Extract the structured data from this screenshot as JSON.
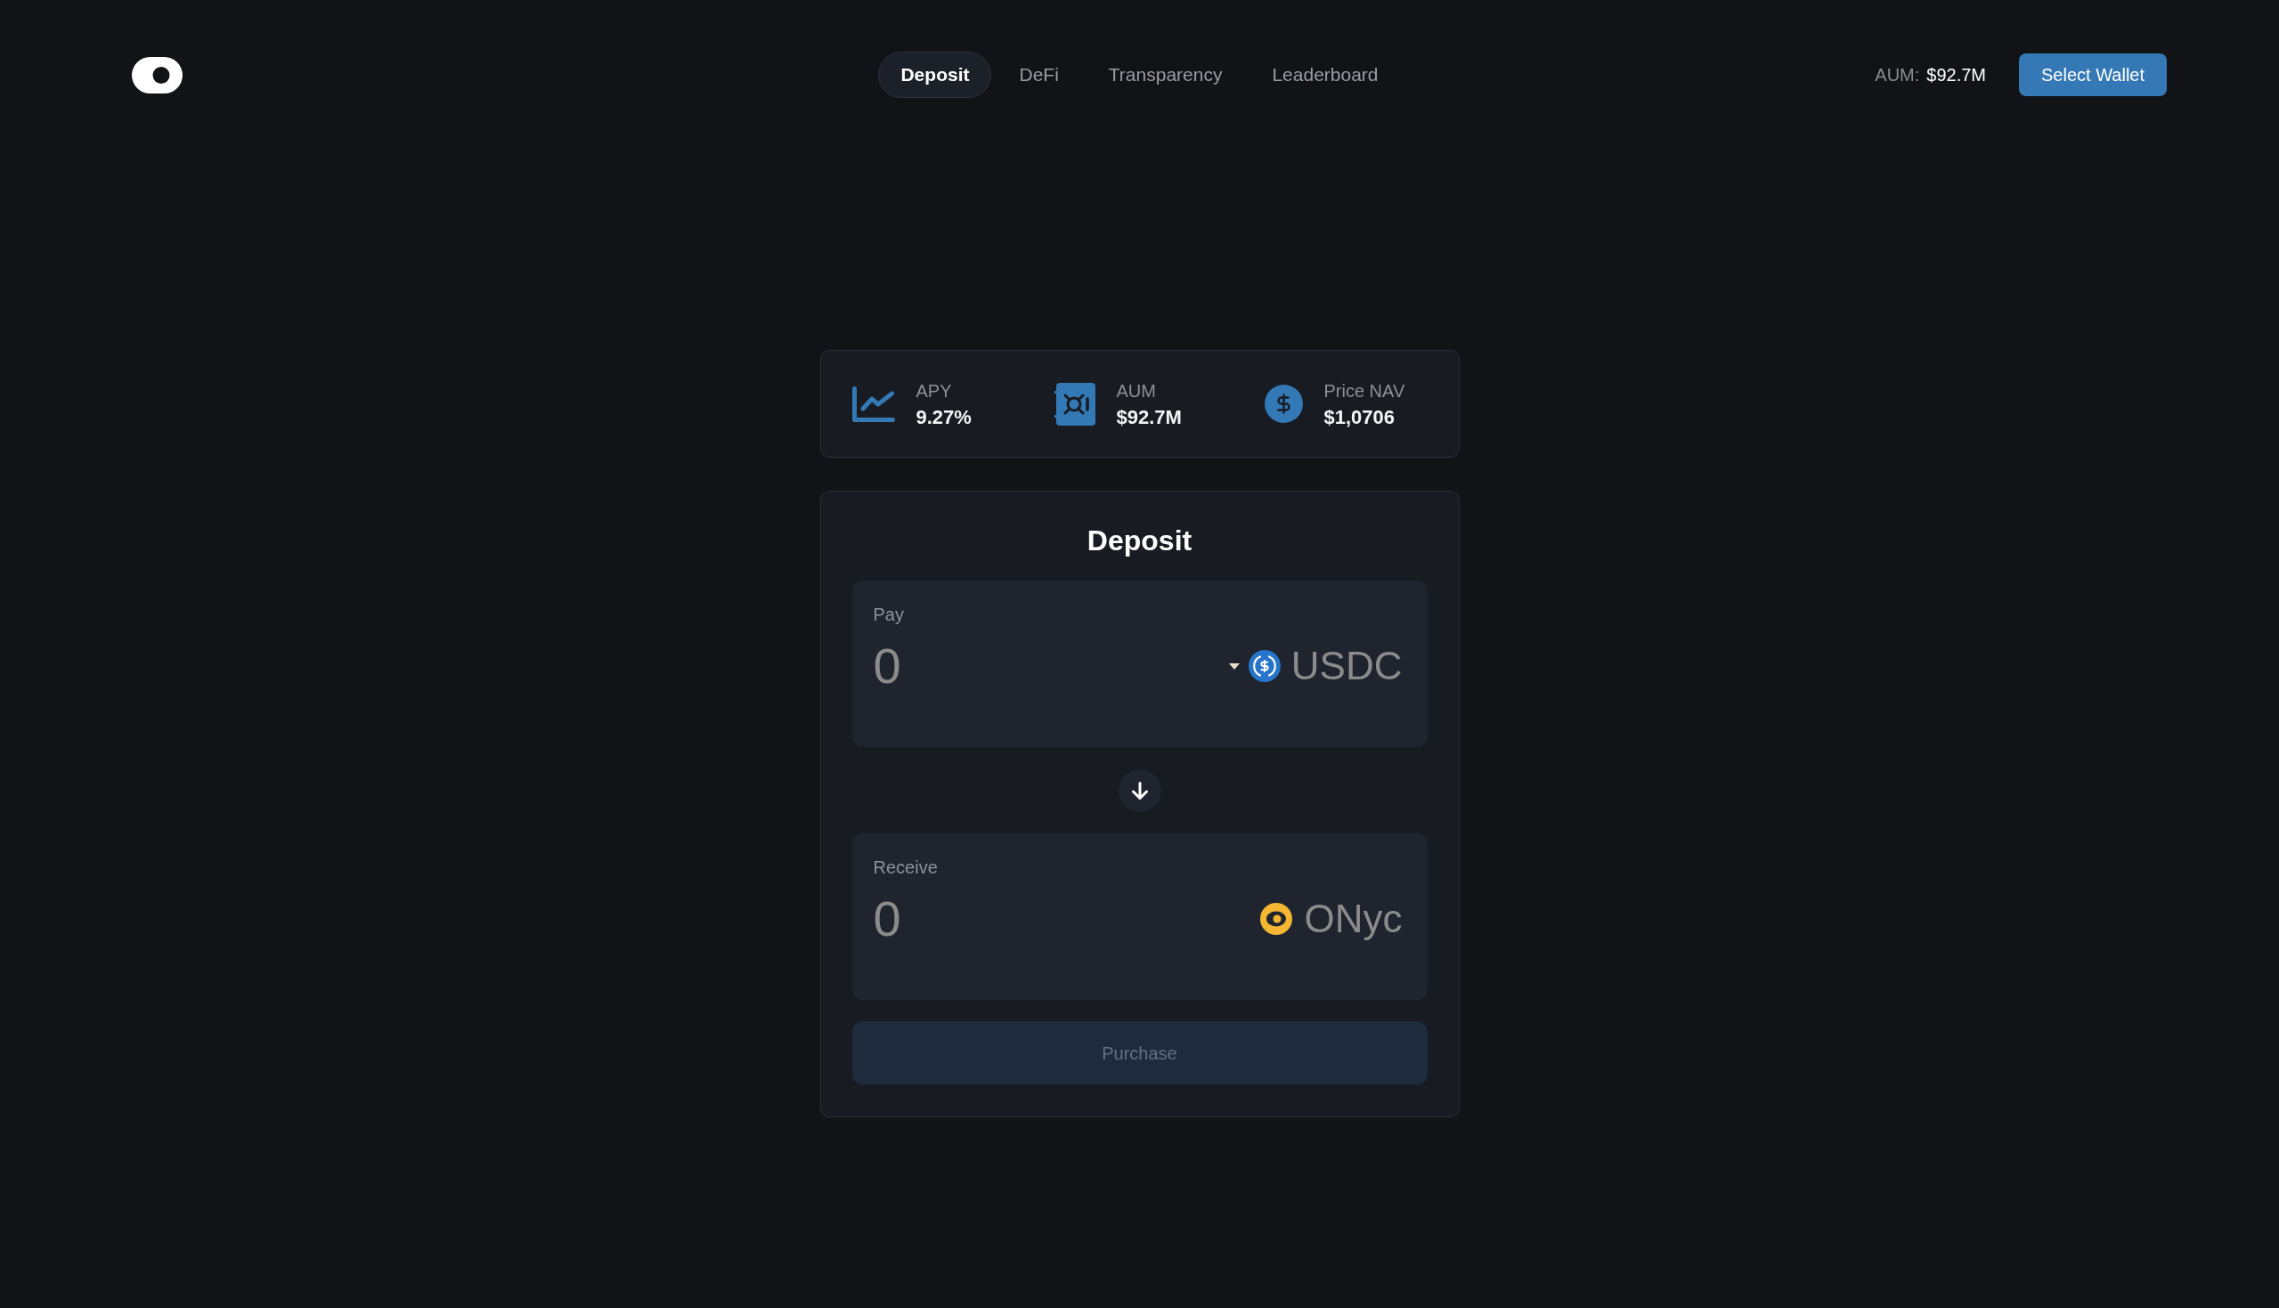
{
  "header": {
    "nav": [
      {
        "label": "Deposit",
        "selected": true
      },
      {
        "label": "DeFi",
        "selected": false
      },
      {
        "label": "Transparency",
        "selected": false
      },
      {
        "label": "Leaderboard",
        "selected": false
      }
    ],
    "aum": {
      "label": "AUM:",
      "value": "$92.7M"
    },
    "wallet_button": "Select Wallet"
  },
  "stats": [
    {
      "label": "APY",
      "value": "9.27%"
    },
    {
      "label": "AUM",
      "value": "$92.7M"
    },
    {
      "label": "Price NAV",
      "value": "$1,0706"
    }
  ],
  "deposit": {
    "title": "Deposit",
    "pay": {
      "label": "Pay",
      "placeholder": "0",
      "token": "USDC",
      "dropdown": true
    },
    "receive": {
      "label": "Receive",
      "placeholder": "0",
      "token": "ONyc",
      "dropdown": false
    },
    "purchase_button": {
      "label": "Purchase",
      "disabled": true
    }
  }
}
